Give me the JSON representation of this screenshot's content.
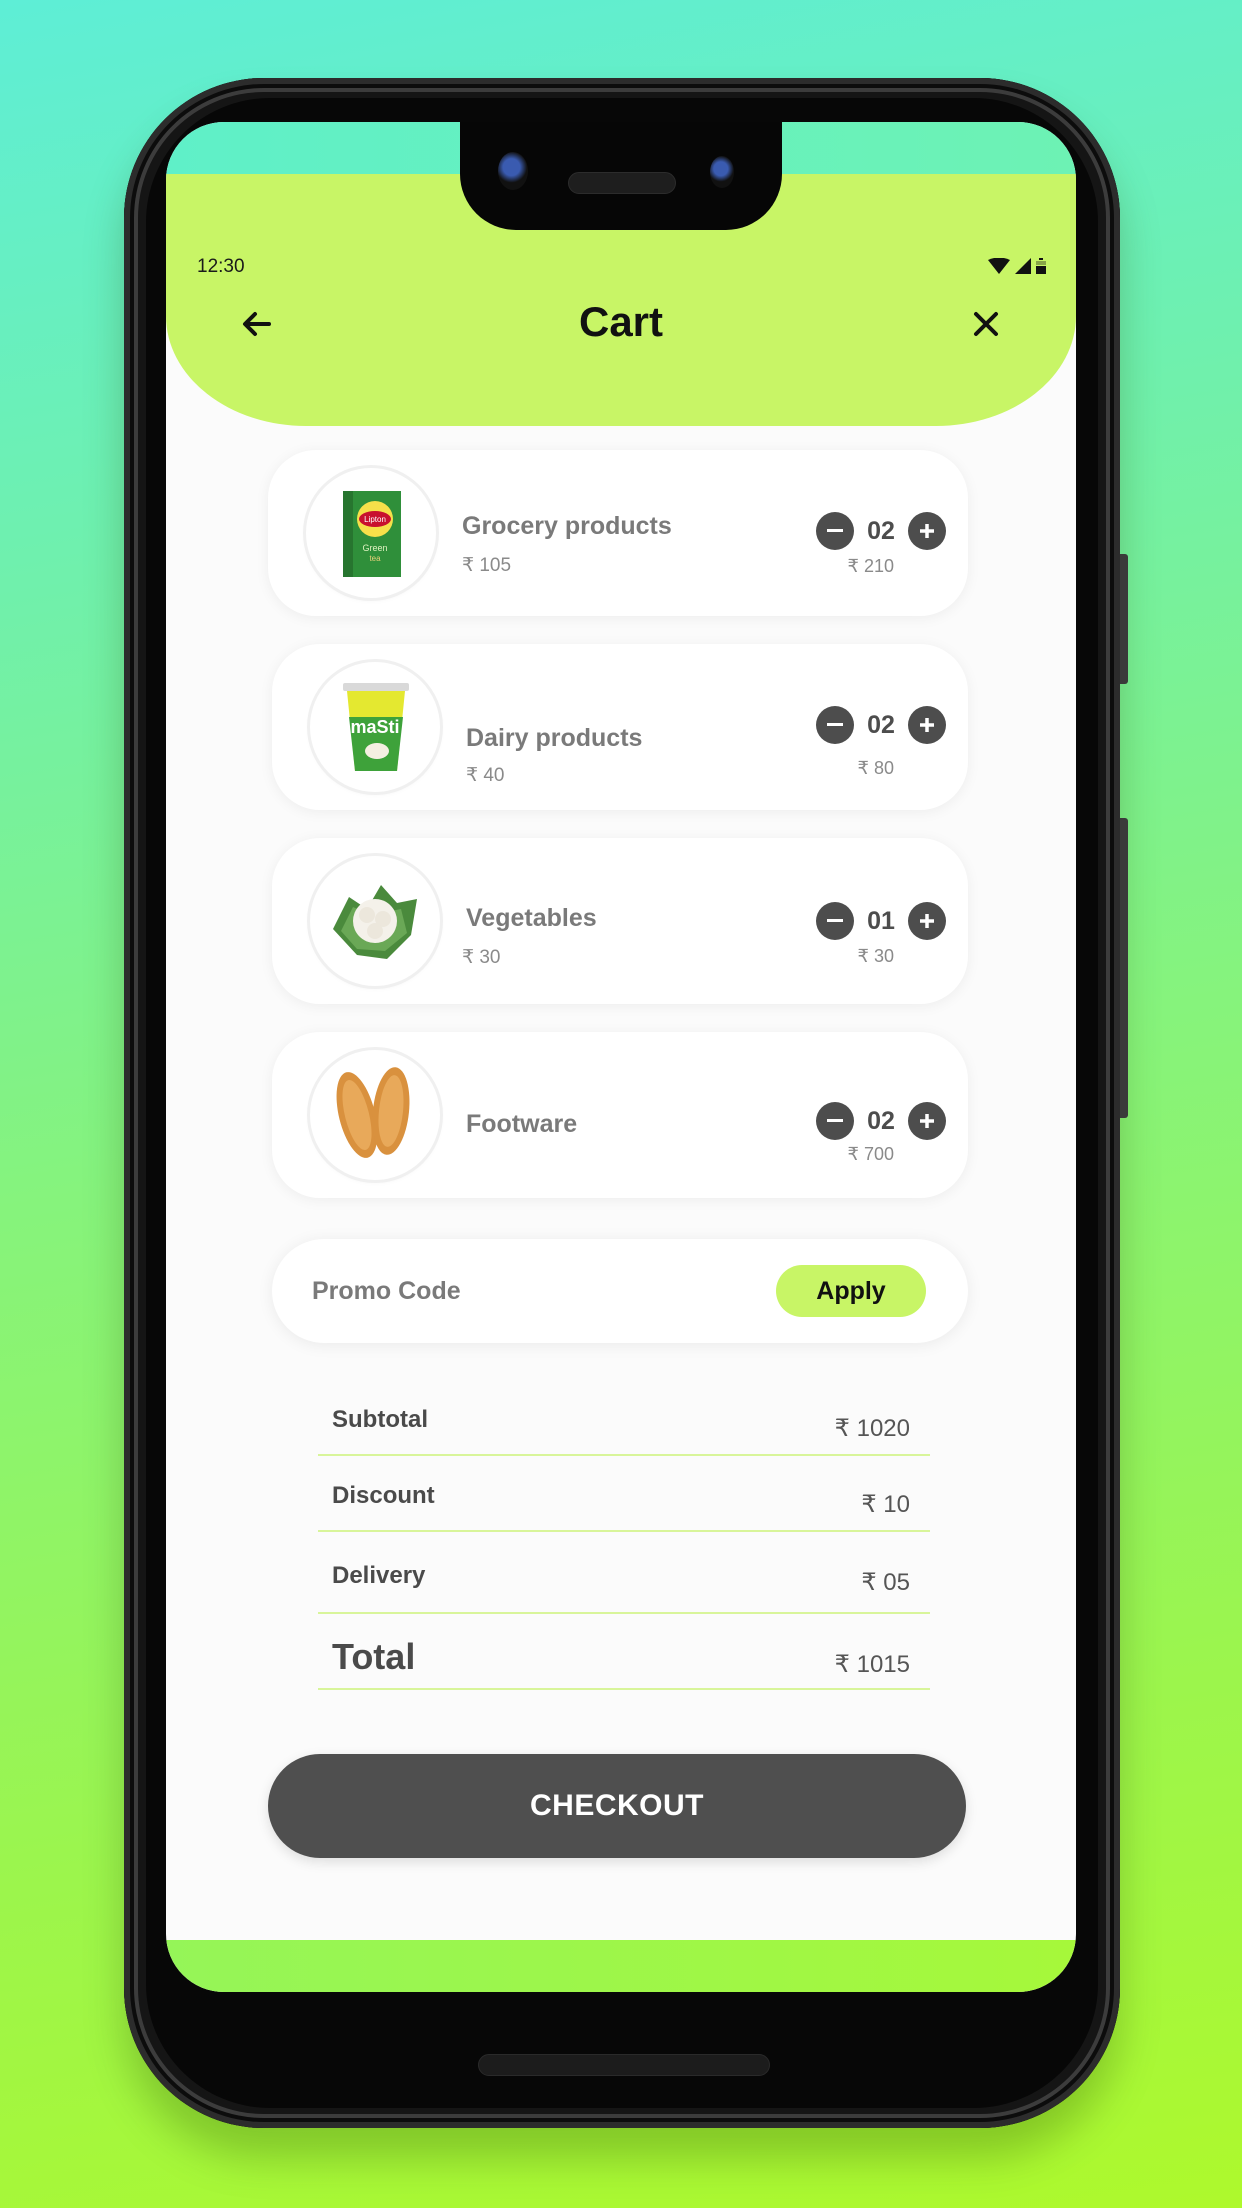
{
  "status_bar": {
    "time": "12:30",
    "icons": [
      "wifi-icon",
      "cellular-signal-icon",
      "battery-icon"
    ]
  },
  "header": {
    "title": "Cart",
    "back_icon": "arrow-left-icon",
    "close_icon": "close-icon"
  },
  "cart": {
    "currency_symbol": "₹",
    "items": [
      {
        "name": "Grocery products",
        "unit_price": "₹ 105",
        "quantity": "02",
        "line_total": "₹ 210",
        "image": "lipton-green-tea-box"
      },
      {
        "name": "Dairy products",
        "unit_price": "₹ 40",
        "quantity": "02",
        "line_total": "₹ 80",
        "image": "amul-masti-cup"
      },
      {
        "name": "Vegetables",
        "unit_price": "₹ 30",
        "quantity": "01",
        "line_total": "₹ 30",
        "image": "cauliflower"
      },
      {
        "name": "Footware",
        "unit_price": "",
        "quantity": "02",
        "line_total": "₹ 700",
        "image": "sandals"
      }
    ]
  },
  "promo": {
    "placeholder": "Promo Code",
    "value": "",
    "apply_label": "Apply"
  },
  "summary": {
    "rows": [
      {
        "label": "Subtotal",
        "value": "₹ 1020"
      },
      {
        "label": "Discount",
        "value": "₹ 10"
      },
      {
        "label": "Delivery",
        "value": "₹ 05"
      }
    ],
    "total": {
      "label": "Total",
      "value": "₹ 1015"
    }
  },
  "checkout": {
    "label": "CHECKOUT"
  },
  "colors": {
    "accent": "#c8f566",
    "button_dark": "#4f4f4f",
    "text_muted": "#7a7a7a",
    "divider": "#d8f59a"
  }
}
